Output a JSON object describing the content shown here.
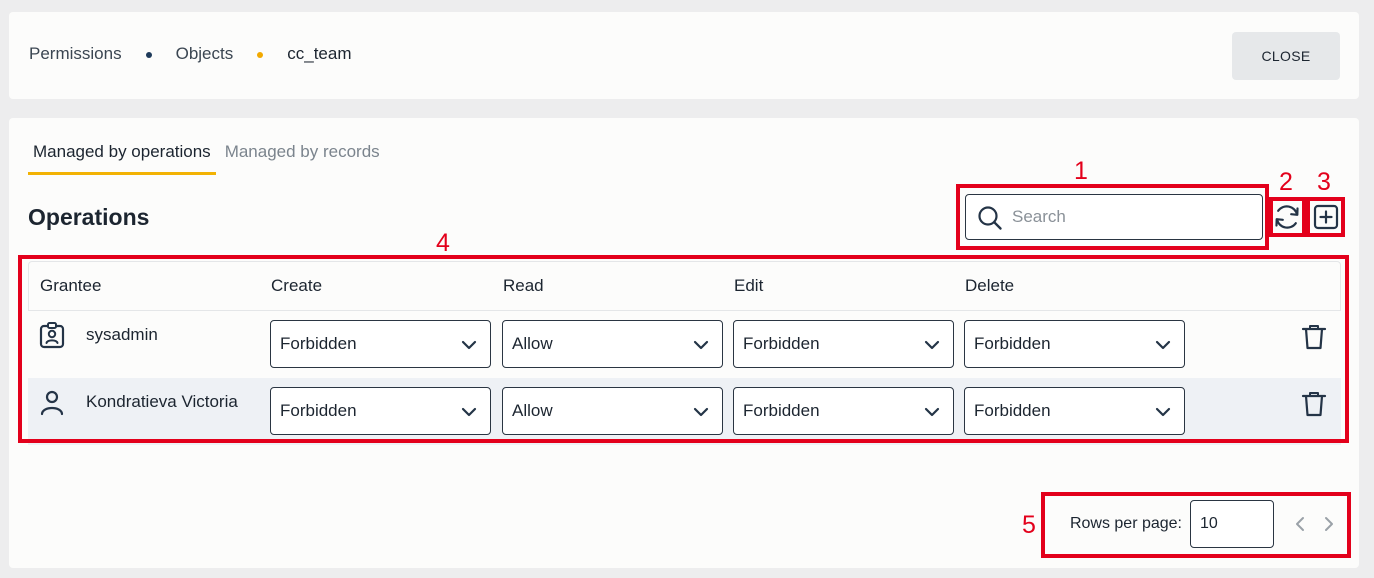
{
  "breadcrumb": {
    "items": [
      "Permissions",
      "Objects",
      "cc_team"
    ]
  },
  "header": {
    "close_label": "CLOSE"
  },
  "tabs": [
    {
      "label": "Managed by operations",
      "active": true
    },
    {
      "label": "Managed by records",
      "active": false
    }
  ],
  "section": {
    "title": "Operations"
  },
  "search": {
    "placeholder": "Search",
    "value": ""
  },
  "table": {
    "columns": [
      "Grantee",
      "Create",
      "Read",
      "Edit",
      "Delete"
    ],
    "rows": [
      {
        "grantee": "sysadmin",
        "icon": "role-badge-icon",
        "create": "Forbidden",
        "read": "Allow",
        "edit": "Forbidden",
        "delete": "Forbidden"
      },
      {
        "grantee": "Kondratieva Victoria",
        "icon": "user-icon",
        "create": "Forbidden",
        "read": "Allow",
        "edit": "Forbidden",
        "delete": "Forbidden"
      }
    ]
  },
  "pager": {
    "rows_label": "Rows per page:",
    "rows_value": "10"
  },
  "annotations": [
    "1",
    "2",
    "3",
    "4",
    "5"
  ],
  "colors": {
    "accent": "#f2b203",
    "annotation": "#e3001b",
    "text": "#1c2530"
  }
}
